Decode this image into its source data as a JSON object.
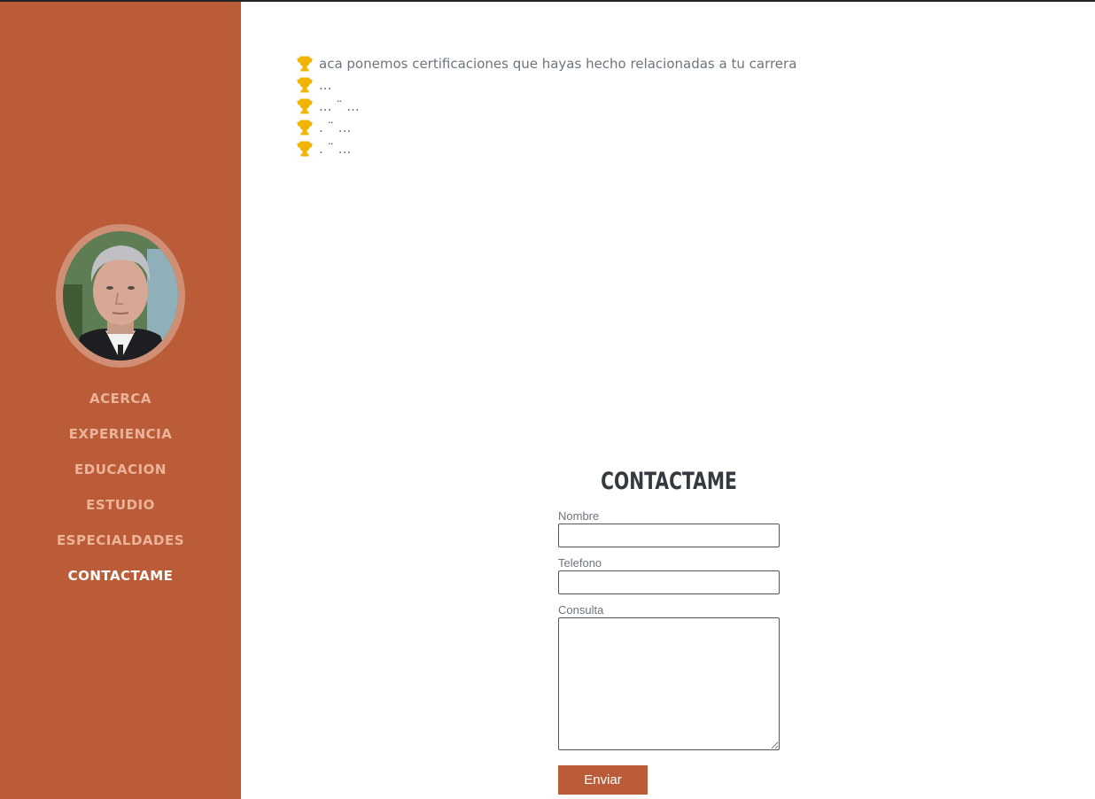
{
  "sidebar": {
    "profile_photo": "profile-photo",
    "nav_items": [
      {
        "label": "ACERCA"
      },
      {
        "label": "EXPERIENCIA"
      },
      {
        "label": "EDUCACION"
      },
      {
        "label": "ESTUDIO"
      },
      {
        "label": "ESPECIALDADES"
      },
      {
        "label": "CONTACTAME",
        "active": true
      }
    ]
  },
  "certifications": {
    "icon": "trophy-icon",
    "items": [
      "aca ponemos certificaciones que hayas hecho relacionadas a tu carrera",
      "...",
      "... ¨ ...",
      ". ¨ ...",
      ". ¨ ..."
    ]
  },
  "contact": {
    "title": "CONTACTAME",
    "name_label": "Nombre",
    "name_value": "",
    "phone_label": "Telefono",
    "phone_value": "",
    "message_label": "Consulta",
    "message_value": "",
    "submit_label": "Enviar"
  },
  "colors": {
    "sidebar_bg": "#bb5c38",
    "nav_text": "#ecb39a",
    "nav_active": "#ffffff",
    "trophy": "#f0b400",
    "button_bg": "#bb5c38"
  }
}
